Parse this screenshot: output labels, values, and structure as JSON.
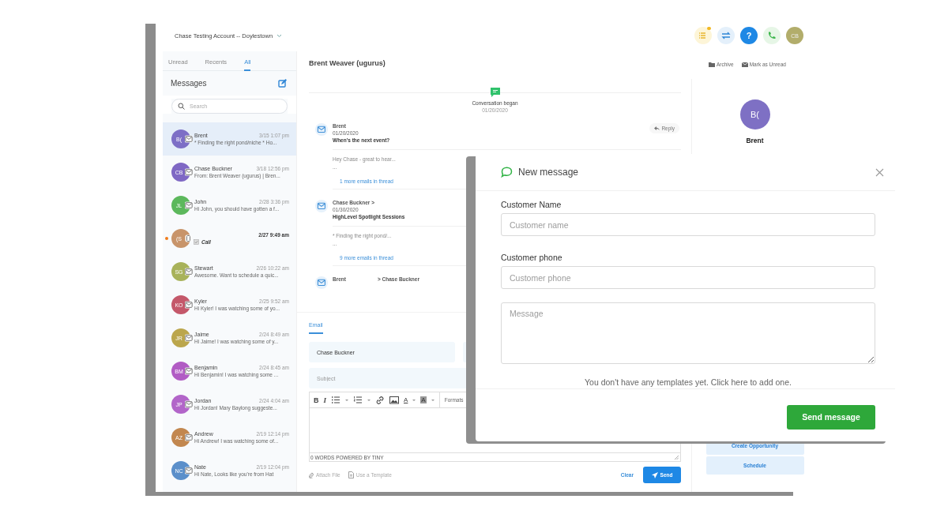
{
  "account": {
    "name": "Chase Testing Account -- Doylestown"
  },
  "top_actions": [
    {
      "kind": "tasks",
      "notification": true
    },
    {
      "kind": "switch"
    },
    {
      "kind": "help",
      "label": "?"
    },
    {
      "kind": "phone"
    },
    {
      "kind": "avatar",
      "label": "CB"
    }
  ],
  "tabs": [
    {
      "label": "Unread",
      "selected": false
    },
    {
      "label": "Recents",
      "selected": false
    },
    {
      "label": "All",
      "selected": true
    }
  ],
  "messages_title": "Messages",
  "search": {
    "placeholder": "Search"
  },
  "conversations": [
    {
      "initials": "B(",
      "color": "#7d6fc6",
      "name": "Brent",
      "time": "3/15 1:07 pm",
      "preview": "* Finding the right pond/niche * Ho...",
      "kind": "email",
      "selected": true,
      "unread": false
    },
    {
      "initials": "CB",
      "color": "#7f68c4",
      "name": "Chase Buckner",
      "time": "3/18 12:56 pm",
      "preview": "From: Brent Weaver (ugurus) | Bren...",
      "kind": "email",
      "selected": false,
      "unread": false
    },
    {
      "initials": "JL",
      "color": "#5cb85c",
      "name": "John",
      "time": "2/28 3:36 pm",
      "preview": "Hi John, you should have gotten a f...",
      "kind": "email",
      "selected": false,
      "unread": false
    },
    {
      "initials": "(S",
      "color": "#c8946a",
      "time": "2/27 9:49 am",
      "preview": "Call",
      "kind": "call",
      "selected": false,
      "unread": true
    },
    {
      "initials": "SG",
      "color": "#a8b25a",
      "name": "Stewart",
      "time": "2/26 10:22 am",
      "preview": "Awesome. Want to schedule a quic...",
      "kind": "email",
      "selected": false,
      "unread": false
    },
    {
      "initials": "KO",
      "color": "#c4586a",
      "name": "Kyler",
      "time": "2/25 9:52 am",
      "preview": "Hi Kyler! I was watching some of yo...",
      "kind": "email",
      "selected": false,
      "unread": false
    },
    {
      "initials": "JR",
      "color": "#bba64c",
      "name": "Jaime",
      "time": "2/24 8:49 am",
      "preview": "Hi Jaime! I was watching some of y...",
      "kind": "email",
      "selected": false,
      "unread": false
    },
    {
      "initials": "BM",
      "color": "#b15cc4",
      "name": "Benjamin",
      "time": "2/24 8:45 am",
      "preview": "Hi Benjamin! I was watching some ...",
      "kind": "email",
      "selected": false,
      "unread": false
    },
    {
      "initials": "JP",
      "color": "#b265c9",
      "name": "Jordan",
      "time": "2/24 4:04 am",
      "preview": "Hi Jordan! Mary Baylong suggeste...",
      "kind": "email",
      "selected": false,
      "unread": false
    },
    {
      "initials": "AZ",
      "color": "#c2874f",
      "name": "Andrew",
      "time": "2/19 12:14 pm",
      "preview": "Hi Andrew! I was watching some of...",
      "kind": "email",
      "selected": false,
      "unread": false
    },
    {
      "initials": "NC",
      "color": "#5b8fca",
      "name": "Nate",
      "time": "2/19 12:04 pm",
      "preview": "Hi Nate, Looks like you're from Hat",
      "kind": "email",
      "selected": false,
      "unread": false
    }
  ],
  "conversation": {
    "title": "Brent Weaver (ugurus)",
    "actions": [
      {
        "kind": "archive",
        "label": "Archive"
      },
      {
        "kind": "unread",
        "label": "Mark as Unread"
      }
    ],
    "event": {
      "label": "Conversation began",
      "date": "01/20/2020"
    },
    "emails": [
      {
        "from": "Brent",
        "date": "01/20/2020",
        "subject": "When's the next event?",
        "reply": "Reply",
        "preview": "Hey Chase - great to hear...",
        "ellipsis": "...",
        "thread_link": "1 more emails in thread"
      },
      {
        "from": "Chase Buckner >",
        "date": "01/30/2020",
        "subject": "HighLevel Spotlight Sessions",
        "preview": "* Finding the right pond/...",
        "ellipsis": "...",
        "thread_link": "9 more emails in thread"
      },
      {
        "from": "Brent",
        "to": "> Chase Buckner"
      }
    ]
  },
  "composer": {
    "tabs": [
      {
        "label": "Email",
        "selected": true
      }
    ],
    "to": "Chase Buckner",
    "subject_placeholder": "Subject",
    "toolbar": [
      {
        "kind": "bold",
        "label": "B"
      },
      {
        "kind": "italic",
        "label": "I"
      },
      {
        "kind": "bullets"
      },
      {
        "kind": "numbers"
      },
      {
        "kind": "link"
      },
      {
        "kind": "image"
      },
      {
        "kind": "forecolor",
        "label": "A"
      },
      {
        "kind": "backcolor",
        "label": "A"
      },
      {
        "kind": "formats",
        "label": "Formats"
      }
    ],
    "status": "0 WORDS POWERED BY TINY",
    "attach": "Attach File",
    "template": "Use a Template",
    "clear": "Clear",
    "send": "Send"
  },
  "contact": {
    "initials": "B(",
    "name": "Brent",
    "actions": [
      "Create Opportunity",
      "Schedule"
    ]
  },
  "modal": {
    "title": "New message",
    "fields": [
      {
        "kind": "input",
        "label": "Customer Name",
        "placeholder": "Customer name"
      },
      {
        "kind": "input",
        "label": "Customer phone",
        "placeholder": "Customer phone"
      },
      {
        "kind": "textarea",
        "placeholder": "Message"
      }
    ],
    "note": "You don't have any templates yet. Click here to add one.",
    "submit": "Send message"
  }
}
